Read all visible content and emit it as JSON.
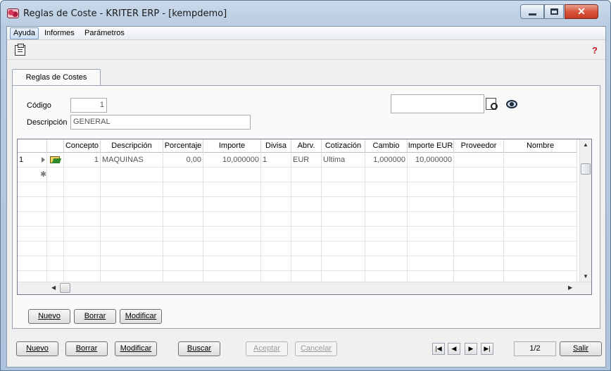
{
  "window": {
    "title": "Reglas de Coste - KRITER ERP - [kempdemo]",
    "close_glyph": "✕"
  },
  "menu": [
    "Ayuda",
    "Informes",
    "Parámetros"
  ],
  "tab": {
    "label": "Reglas de Costes"
  },
  "form": {
    "codigo_label": "Código",
    "codigo_value": "1",
    "descripcion_label": "Descripción",
    "descripcion_value": "GENERAL",
    "search_value": ""
  },
  "grid": {
    "columns": [
      "Concepto",
      "Descripción",
      "Porcentaje",
      "Importe",
      "Divisa",
      "Abrv.",
      "Cotización",
      "Cambio",
      "Importe EUR",
      "Proveedor",
      "Nombre"
    ],
    "rows": [
      {
        "index": "1",
        "concepto": "1",
        "descripcion": "MAQUINAS",
        "porcentaje": "0,00",
        "importe": "10,000000",
        "divisa": "1",
        "abrv": "EUR",
        "cotizacion": "Ultima",
        "cambio": "1,000000",
        "importe_eur": "10,000000",
        "proveedor": "",
        "nombre": ""
      }
    ],
    "new_row_marker": "✱"
  },
  "panel_buttons": {
    "nuevo": "Nuevo",
    "borrar": "Borrar",
    "modificar": "Modificar"
  },
  "bottom_buttons": {
    "nuevo": "Nuevo",
    "borrar": "Borrar",
    "modificar": "Modificar",
    "buscar": "Buscar",
    "aceptar": "Aceptar",
    "cancelar": "Cancelar",
    "salir": "Salir"
  },
  "pager": {
    "text": "1/2"
  },
  "nav_glyphs": {
    "first": "|◀",
    "prev": "◀",
    "next": "▶",
    "last": "▶|"
  },
  "icons": [
    "app-icon",
    "clipboard-icon",
    "help-icon",
    "document-search-icon",
    "eye-icon",
    "folder-open-icon"
  ],
  "colors": {
    "close_button": "#d8553b",
    "title_bar": "#b7cbe0"
  }
}
